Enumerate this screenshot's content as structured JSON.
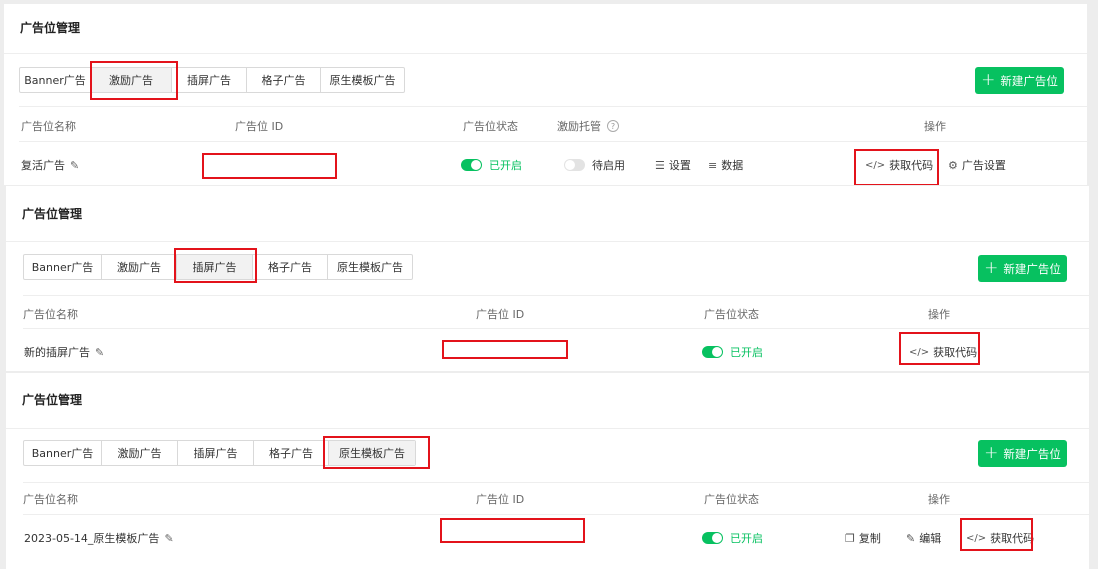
{
  "section1": {
    "title": "广告位管理",
    "tabs": [
      "Banner广告",
      "激励广告",
      "插屏广告",
      "格子广告",
      "原生模板广告"
    ],
    "new_button": "新建广告位",
    "headers": {
      "name": "广告位名称",
      "id": "广告位 ID",
      "status": "广告位状态",
      "hosting": "激励托管",
      "ops": "操作"
    },
    "row": {
      "name": "复活广告",
      "status": "已开启",
      "hosting_status": "待启用",
      "settings": "设置",
      "data": "数据",
      "get_code": "获取代码",
      "ad_settings": "广告设置"
    }
  },
  "section2": {
    "title": "广告位管理",
    "tabs": [
      "Banner广告",
      "激励广告",
      "插屏广告",
      "格子广告",
      "原生模板广告"
    ],
    "new_button": "新建广告位",
    "headers": {
      "name": "广告位名称",
      "id": "广告位 ID",
      "status": "广告位状态",
      "ops": "操作"
    },
    "row": {
      "name": "新的插屏广告",
      "status": "已开启",
      "get_code": "获取代码"
    }
  },
  "section3": {
    "title": "广告位管理",
    "tabs": [
      "Banner广告",
      "激励广告",
      "插屏广告",
      "格子广告",
      "原生模板广告"
    ],
    "new_button": "新建广告位",
    "headers": {
      "name": "广告位名称",
      "id": "广告位 ID",
      "status": "广告位状态",
      "ops": "操作"
    },
    "row": {
      "name": "2023-05-14_原生模板广告",
      "status": "已开启",
      "copy": "复制",
      "edit": "编辑",
      "get_code": "获取代码"
    }
  },
  "colors": {
    "accent": "#07c160",
    "highlight": "#e3131b"
  }
}
